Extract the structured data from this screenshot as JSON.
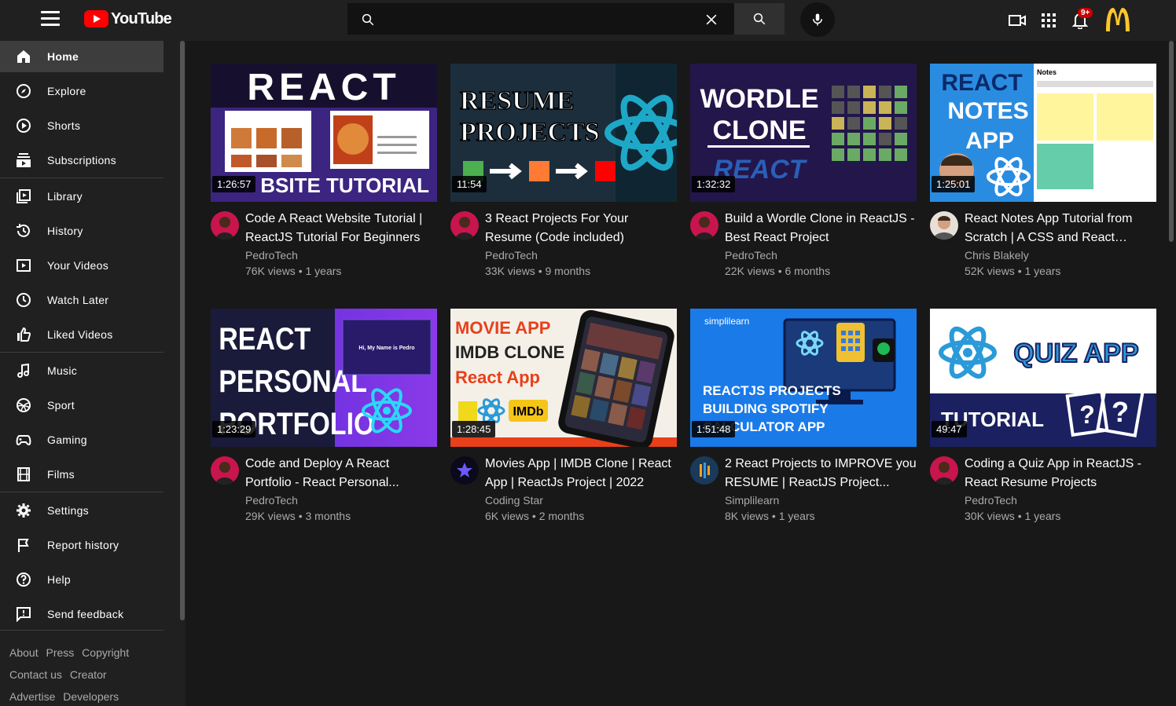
{
  "brand": {
    "name": "YouTube"
  },
  "search": {
    "placeholder": "",
    "value": ""
  },
  "notifications": {
    "count": "9+"
  },
  "sidebar": {
    "items": [
      {
        "label": "Home",
        "icon": "home-icon"
      },
      {
        "label": "Explore",
        "icon": "compass-icon"
      },
      {
        "label": "Shorts",
        "icon": "shorts-icon"
      },
      {
        "label": "Subscriptions",
        "icon": "subscriptions-icon"
      },
      {
        "label": "Library",
        "icon": "library-icon"
      },
      {
        "label": "History",
        "icon": "history-icon"
      },
      {
        "label": "Your Videos",
        "icon": "your-videos-icon"
      },
      {
        "label": "Watch Later",
        "icon": "clock-icon"
      },
      {
        "label": "Liked Videos",
        "icon": "thumbs-up-icon"
      },
      {
        "label": "Music",
        "icon": "music-note-icon"
      },
      {
        "label": "Sport",
        "icon": "trophy-icon"
      },
      {
        "label": "Gaming",
        "icon": "gamepad-icon"
      },
      {
        "label": "Films",
        "icon": "film-icon"
      },
      {
        "label": "Settings",
        "icon": "gear-icon"
      },
      {
        "label": "Report history",
        "icon": "flag-icon"
      },
      {
        "label": "Help",
        "icon": "help-icon"
      },
      {
        "label": "Send feedback",
        "icon": "feedback-icon"
      }
    ],
    "footer": {
      "row1": [
        "About",
        "Press",
        "Copyright"
      ],
      "row2": [
        "Contact us",
        "Creator"
      ],
      "row3": [
        "Advertise",
        "Developers"
      ]
    }
  },
  "videos": [
    {
      "title": "Code A React Website Tutorial | ReactJS Tutorial For Beginners",
      "channel": "PedroTech",
      "meta": "76K views • 1 years",
      "duration": "1:26:57",
      "thumb_text": [
        "REACT",
        "BSITE TUTORIAL"
      ]
    },
    {
      "title": "3 React Projects For Your Resume (Code included)",
      "channel": "PedroTech",
      "meta": "33K views • 9 months",
      "duration": "11:54",
      "thumb_text": [
        "RESUME",
        "PROJECTS"
      ]
    },
    {
      "title": "Build a Wordle Clone in ReactJS - Best React Project",
      "channel": "PedroTech",
      "meta": "22K views • 6 months",
      "duration": "1:32:32",
      "thumb_text": [
        "WORDLE",
        "CLONE",
        "REACT"
      ]
    },
    {
      "title": "React Notes App Tutorial from Scratch | A CSS and React Proje...",
      "channel": "Chris Blakely",
      "meta": "52K views • 1 years",
      "duration": "1:25:01",
      "thumb_text": [
        "REACT",
        "NOTES",
        "APP",
        "Notes"
      ]
    },
    {
      "title": "Code and Deploy A React Portfolio - React Personal...",
      "channel": "PedroTech",
      "meta": "29K views • 3 months",
      "duration": "1:23:29",
      "thumb_text": [
        "REACT",
        "PERSONAL",
        "PORTFOLIO",
        "Hi, My Name is Pedro"
      ]
    },
    {
      "title": "Movies App | IMDB Clone | React App | ReactJs Project | 2022",
      "channel": "Coding Star",
      "meta": "6K views • 2 months",
      "duration": "1:28:45",
      "thumb_text": [
        "MOVIE APP",
        "IMDB CLONE",
        "React App",
        "IMDb"
      ]
    },
    {
      "title": "2 React Projects to IMPROVE you RESUME | ReactJS Project...",
      "channel": "Simplilearn",
      "meta": "8K views • 1 years",
      "duration": "1:51:48",
      "thumb_text": [
        "simplilearn",
        "REACTJS PROJECTS",
        "BUILDING SPOTIFY",
        "CALCULATOR APP"
      ]
    },
    {
      "title": "Coding a Quiz App in ReactJS - React Resume Projects",
      "channel": "PedroTech",
      "meta": "30K views • 1 years",
      "duration": "49:47",
      "thumb_text": [
        "QUIZ APP",
        "TUTORIAL",
        "?",
        "?"
      ]
    }
  ]
}
